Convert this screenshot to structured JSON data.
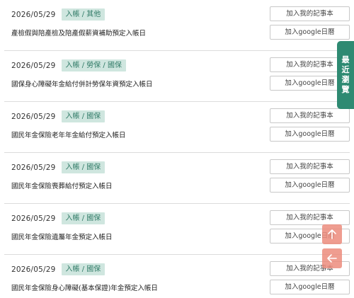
{
  "items": [
    {
      "date": "2026/05/29",
      "tag": "入帳 / 其他",
      "desc": "產檢假與陪產檢及陪產假薪資補助預定入帳日"
    },
    {
      "date": "2026/05/29",
      "tag": "入帳 / 勞保 / 國保",
      "desc": "國保身心障礙年金給付併計勞保年資預定入帳日"
    },
    {
      "date": "2026/05/29",
      "tag": "入帳 / 國保",
      "desc": "國民年金保險老年年金給付預定入帳日"
    },
    {
      "date": "2026/05/29",
      "tag": "入帳 / 國保",
      "desc": "國民年金保險喪葬給付預定入帳日"
    },
    {
      "date": "2026/05/29",
      "tag": "入帳 / 國保",
      "desc": "國民年金保險遺屬年金預定入帳日"
    },
    {
      "date": "2026/05/29",
      "tag": "入帳 / 國保",
      "desc": "國民年金保險身心障礙(基本保證)年金預定入帳日"
    }
  ],
  "buttons": {
    "note_label": "加入我的記事本",
    "gcal_label": "加入google日曆"
  },
  "side_tab": {
    "line1": "最",
    "line2": "近",
    "line3": "瀏",
    "line4": "覽"
  },
  "icons": {
    "scroll_top": "arrow-up-icon",
    "back": "arrow-left-icon"
  },
  "colors": {
    "accent": "#2e8a72",
    "tag_bg": "#cfe6df",
    "tag_text": "#2f7a66",
    "float_btn": "#ec8c7d"
  }
}
